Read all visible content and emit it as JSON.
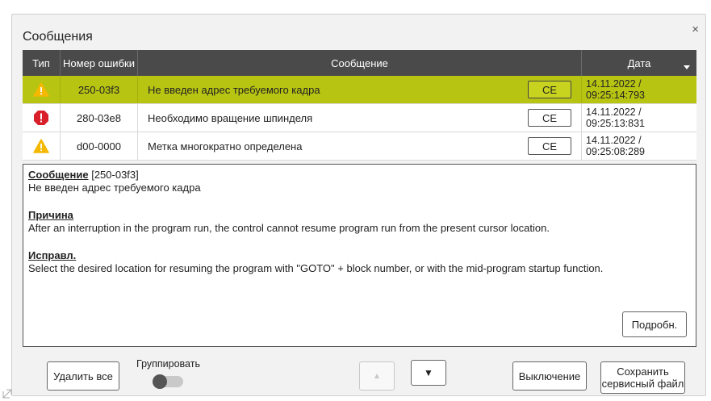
{
  "dialog": {
    "title": "Сообщения",
    "close_label": "×"
  },
  "table": {
    "headers": {
      "type": "Тип",
      "number": "Номер ошибки",
      "message": "Сообщение",
      "date": "Дата"
    },
    "rows": [
      {
        "icon": "warning-icon",
        "number": "250-03f3",
        "message": "Не введен адрес требуемого кадра",
        "ce": "CE",
        "date": "14.11.2022 / 09:25:14:793",
        "selected": true
      },
      {
        "icon": "error-icon",
        "number": "280-03e8",
        "message": "Необходимо вращение шпинделя",
        "ce": "CE",
        "date": "14.11.2022 / 09:25:13:831",
        "selected": false
      },
      {
        "icon": "warning-icon",
        "number": "d00-0000",
        "message": "Метка многократно определена",
        "ce": "CE",
        "date": "14.11.2022 / 09:25:08:289",
        "selected": false
      }
    ]
  },
  "detail": {
    "message_heading": "Сообщение",
    "message_code": "[250-03f3]",
    "message_text": "Не введен адрес требуемого кадра",
    "cause_heading": "Причина",
    "cause_text": "After an interruption in the program run, the control cannot resume program run from the present cursor location.",
    "fix_heading": "Исправл.",
    "fix_text": "Select the desired location for resuming the program with \"GOTO\" + block number, or with the mid-program startup function.",
    "more_button": "Подробн."
  },
  "footer": {
    "delete_all": "Удалить все",
    "group_label": "Группировать",
    "group_on": false,
    "up_arrow": "▲",
    "down_arrow": "▼",
    "shutdown": "Выключение",
    "save_service_line1": "Сохранить",
    "save_service_line2": "сервисный файл"
  },
  "colors": {
    "selected_row": "#b8c412",
    "header_bg": "#4a4a4a",
    "warning": "#f5b800",
    "error": "#d9202a"
  }
}
